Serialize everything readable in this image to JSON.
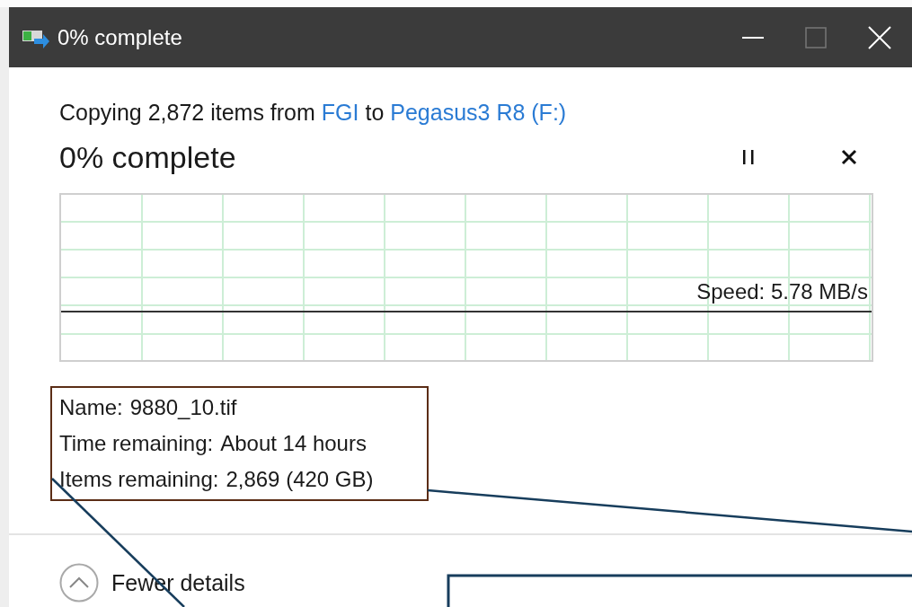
{
  "window": {
    "title": "0% complete"
  },
  "summary": {
    "prefix": "Copying 2,872 items from",
    "source": "FGI",
    "joiner": "to",
    "destination": "Pegasus3 R8 (F:)"
  },
  "heading": "0% complete",
  "graph": {
    "speed": "Speed: 5.78 MB/s"
  },
  "details": [
    {
      "label": "Name:",
      "value": "9880_10.tif"
    },
    {
      "label": "Time remaining:",
      "value": "About 14 hours"
    },
    {
      "label": "Items remaining:",
      "value": "2,869 (420 GB)"
    }
  ],
  "toggle": {
    "label": "Fewer details",
    "expanded": true
  }
}
